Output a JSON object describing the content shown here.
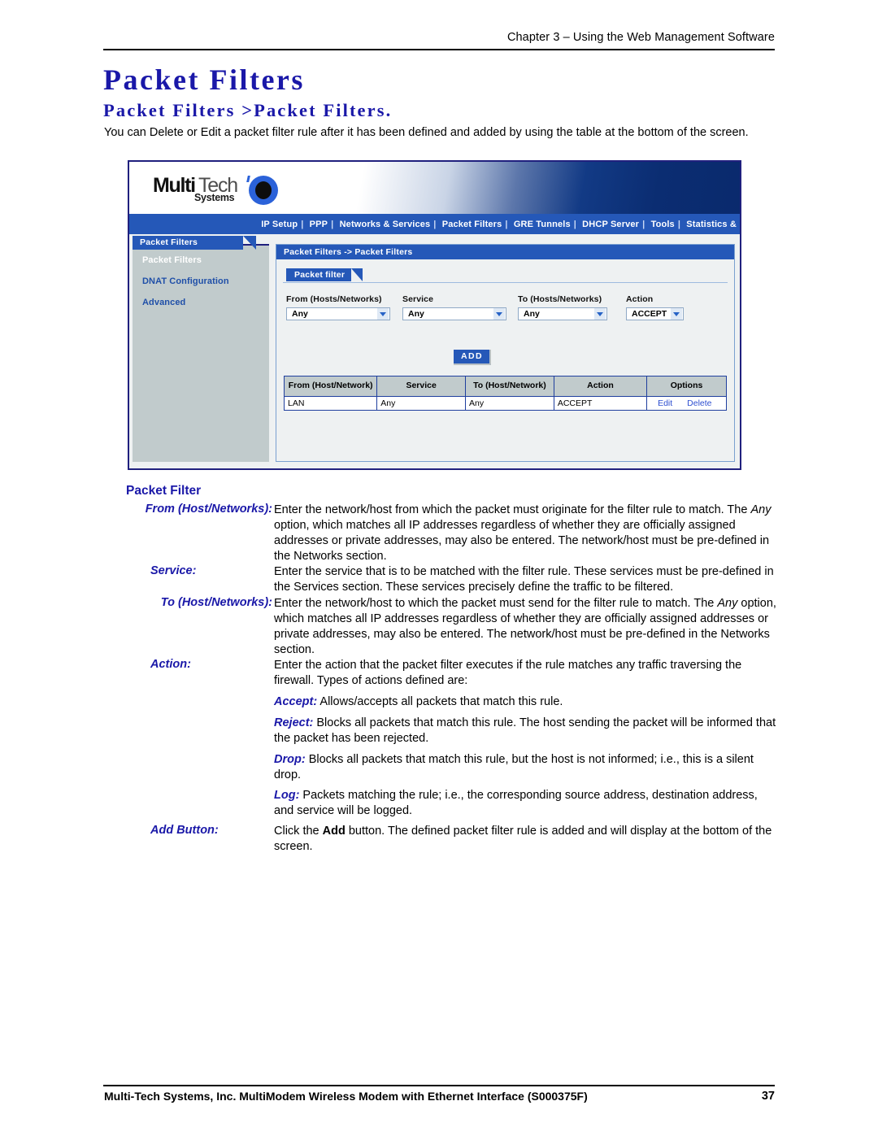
{
  "header": {
    "running_head": "Chapter 3 – Using the Web Management Software"
  },
  "titles": {
    "main": "Packet Filters",
    "sub": "Packet Filters >Packet Filters.",
    "intro": "You can Delete or Edit a packet filter rule after it has been defined and added by using the table at the bottom of the screen."
  },
  "screenshot": {
    "logo": {
      "multi": "Multi",
      "tech": "Tech",
      "systems": "Systems"
    },
    "nav": {
      "items": [
        "IP Setup",
        "PPP",
        "Networks & Services",
        "Packet Filters",
        "GRE Tunnels",
        "DHCP Server",
        "Tools",
        "Statistics &"
      ],
      "separator": "|"
    },
    "sidebar": {
      "tab_label": "Packet Filters",
      "items": [
        {
          "label": "Packet Filters",
          "active": true
        },
        {
          "label": "DNAT Configuration",
          "active": false
        },
        {
          "label": "Advanced",
          "active": false
        }
      ]
    },
    "panel": {
      "breadcrumb": "Packet Filters  ->  Packet Filters",
      "tab_label": "Packet filter",
      "fields": [
        {
          "label": "From (Hosts/Networks)",
          "value": "Any"
        },
        {
          "label": "Service",
          "value": "Any"
        },
        {
          "label": "To (Hosts/Networks)",
          "value": "Any"
        },
        {
          "label": "Action",
          "value": "ACCEPT"
        }
      ],
      "add_button": "ADD",
      "table": {
        "columns": [
          "From (Host/Network)",
          "Service",
          "To (Host/Network)",
          "Action",
          "Options"
        ],
        "rows": [
          {
            "from": "LAN",
            "service": "Any",
            "to": "Any",
            "action": "ACCEPT",
            "options": [
              "Edit",
              "Delete"
            ]
          }
        ]
      }
    }
  },
  "section": {
    "title": "Packet Filter",
    "definitions": [
      {
        "term": "From (Host/Networks):",
        "body_html": "Enter the network/host from which the packet must originate for the filter rule to match. The <span class=\"it\">Any</span> option, which matches all IP addresses regardless of whether they are officially assigned addresses or private addresses, may also be entered. The network/host must be pre-defined in the Networks section."
      },
      {
        "term": "Service:",
        "term_align": "left",
        "body_html": "Enter the service that is to be matched with the filter rule. These services must be pre-defined in the Services section. These services precisely define the traffic to be filtered."
      },
      {
        "term": "To (Host/Networks):",
        "body_html": "Enter the network/host to which the packet must send for the filter rule to match. The <span class=\"it\">Any</span> option, which matches all IP addresses regardless of whether they are officially assigned addresses or private addresses, may also be entered. The network/host must be pre-defined in the Networks section."
      },
      {
        "term": "Action:",
        "term_align": "left",
        "body_html": "Enter the action that the packet filter executes if the rule matches any traffic traversing the firewall. Types of actions defined are:",
        "sub_items": [
          {
            "term": "Accept:",
            "text": " Allows/accepts all packets that match this rule."
          },
          {
            "term": "Reject:",
            "text": " Blocks all packets that match this rule. The host sending the packet will be informed that the packet has been rejected."
          },
          {
            "term": "Drop:",
            "text": " Blocks all packets that match this rule, but the host is not informed; i.e., this is a silent drop."
          },
          {
            "term": "Log:",
            "text": " Packets matching the rule; i.e., the corresponding source address, destination address, and service will be logged."
          }
        ]
      },
      {
        "term": "Add Button:",
        "term_align": "left",
        "body_html": "Click the <span class=\"bd\">Add</span> button. The defined packet filter rule is added and will display at the bottom of the screen."
      }
    ]
  },
  "footer": {
    "text": "Multi-Tech Systems, Inc. MultiModem Wireless Modem with Ethernet Interface (S000375F)",
    "page_number": "37"
  },
  "colors": {
    "heading_blue": "#1a18a8",
    "ui_blue": "#2558b8",
    "sidebar_gray": "#c1cbcc",
    "link_blue": "#2e4fd0"
  }
}
